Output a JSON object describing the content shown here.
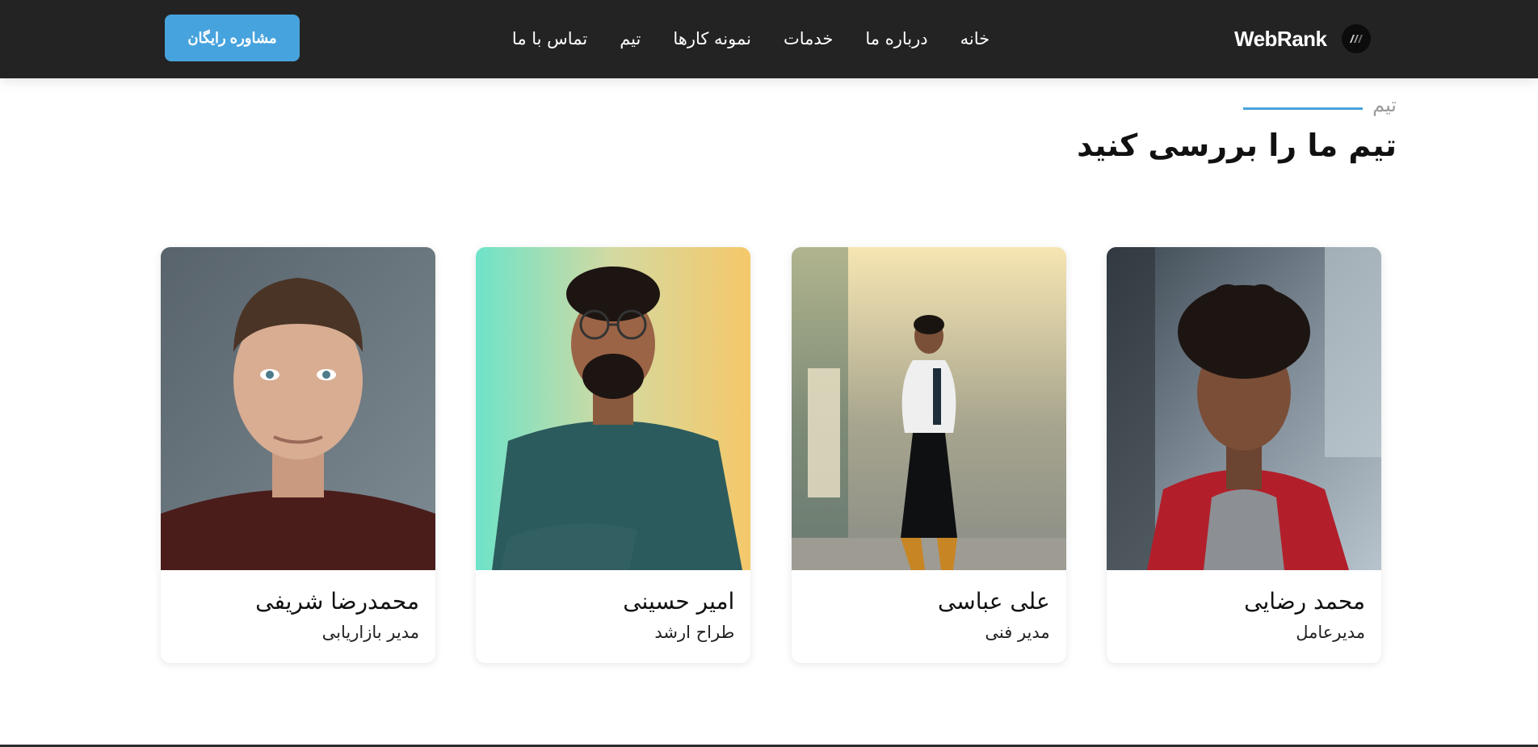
{
  "nav": {
    "brand": "WebRank",
    "items": [
      {
        "label": "خانه"
      },
      {
        "label": "درباره ما"
      },
      {
        "label": "خدمات"
      },
      {
        "label": "نمونه کارها"
      },
      {
        "label": "تیم"
      },
      {
        "label": "تماس با ما"
      }
    ],
    "cta_label": "مشاوره رایگان"
  },
  "section": {
    "eyebrow": "تیم",
    "title": "تیم ما را بررسی کنید"
  },
  "team": [
    {
      "name": "محمد رضایی",
      "role": "مدیرعامل"
    },
    {
      "name": "علی عباسی",
      "role": "مدیر فنی"
    },
    {
      "name": "امیر حسینی",
      "role": "طراح ارشد"
    },
    {
      "name": "محمدرضا شریفی",
      "role": "مدیر بازاریابی"
    }
  ],
  "colors": {
    "navbar": "#232323",
    "accent": "#47a3dd",
    "eyebrow": "#9a9a9a"
  }
}
